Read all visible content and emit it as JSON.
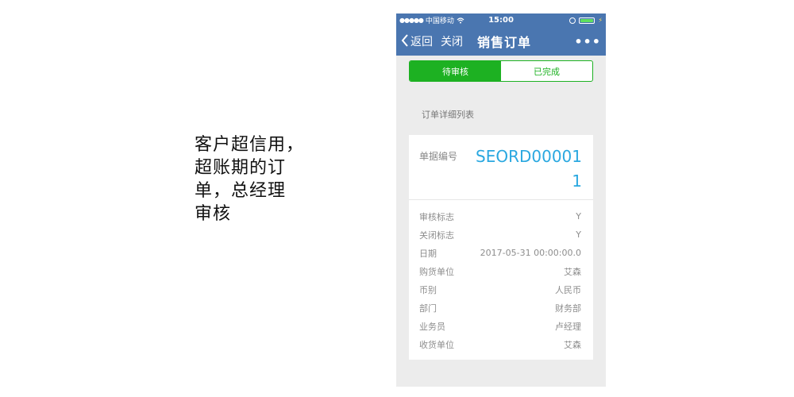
{
  "caption": "客户超信用，\n超账期的订\n单，总经理\n审核",
  "status_bar": {
    "signal": "●●●●●",
    "carrier": "中国移动",
    "wifi_icon": "wifi-icon",
    "time": "15:00",
    "lock_icon": "lock-icon",
    "battery_icon": "battery-icon"
  },
  "nav": {
    "back": "返回",
    "close": "关闭",
    "title": "销售订单",
    "more": "•••"
  },
  "tabs": [
    {
      "label": "待审核",
      "active": true
    },
    {
      "label": "已完成",
      "active": false
    }
  ],
  "section_label": "订单详细列表",
  "order": {
    "number_label": "单据编号",
    "number_value": "SEORD000011",
    "fields": [
      {
        "label": "审核标志",
        "value": "Y"
      },
      {
        "label": "关闭标志",
        "value": "Y"
      },
      {
        "label": "日期",
        "value": "2017-05-31 00:00:00.0"
      },
      {
        "label": "购货单位",
        "value": "艾森"
      },
      {
        "label": "币别",
        "value": "人民币"
      },
      {
        "label": "部门",
        "value": "财务部"
      },
      {
        "label": "业务员",
        "value": "卢经理"
      },
      {
        "label": "收货单位",
        "value": "艾森"
      }
    ]
  },
  "colors": {
    "nav_bg": "#4a76b0",
    "tab_green": "#1db122",
    "order_number": "#2aa8e0"
  }
}
